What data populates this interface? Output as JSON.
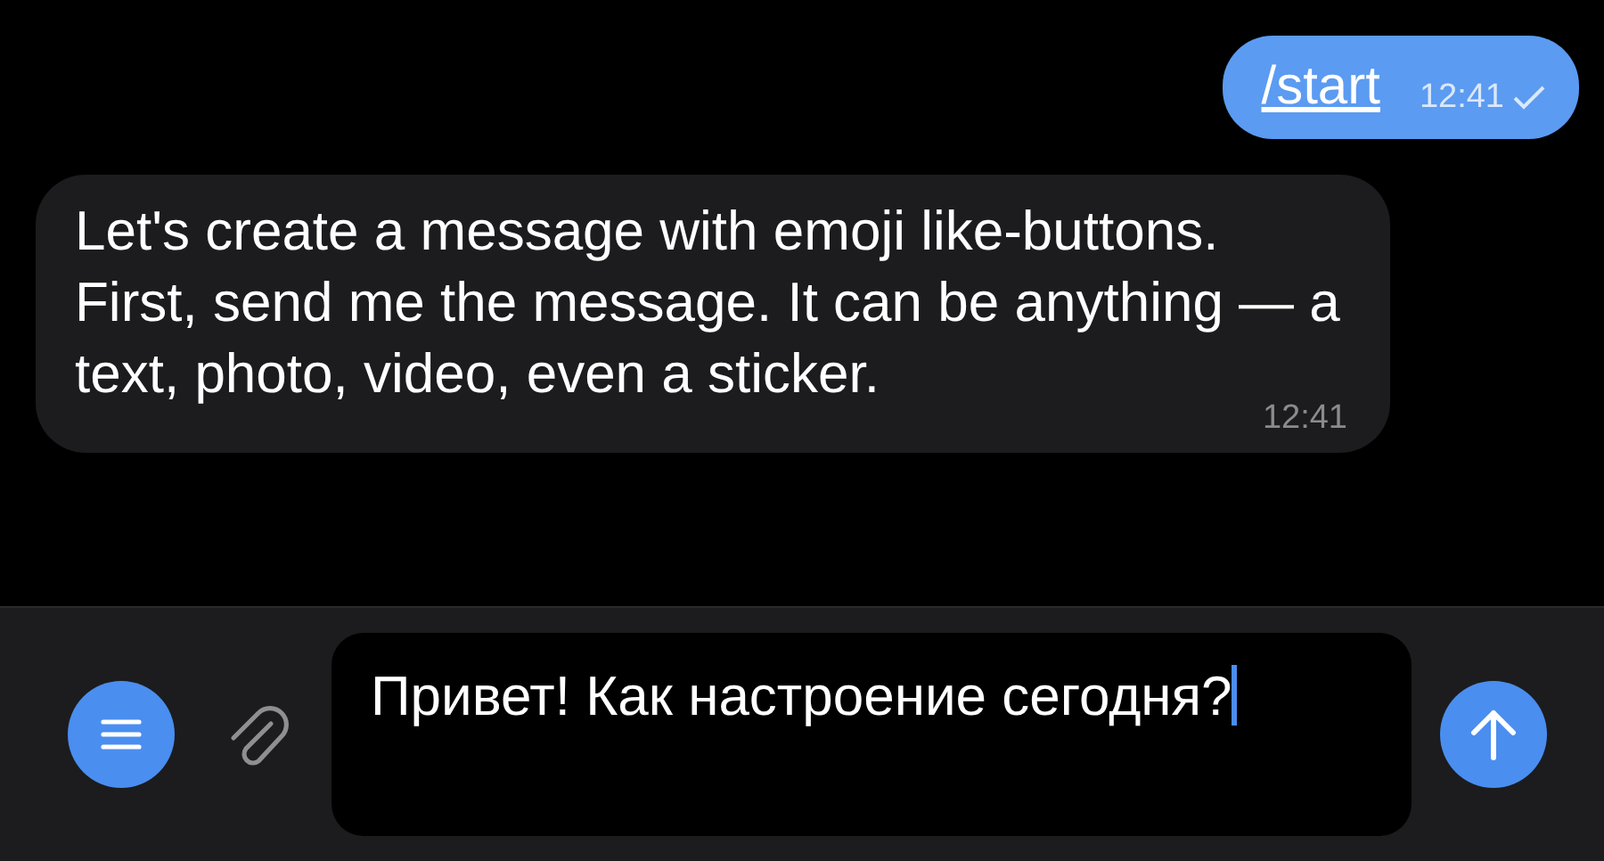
{
  "messages": [
    {
      "kind": "outgoing",
      "text": "/start",
      "time": "12:41",
      "delivered": true
    },
    {
      "kind": "incoming",
      "text": "Let's create a message with emoji like-buttons. First, send me the message. It can be anything — a text, photo, video, even a sticker.",
      "time": "12:41"
    }
  ],
  "composer": {
    "value": "Привет! Как настроение сегодня?"
  }
}
